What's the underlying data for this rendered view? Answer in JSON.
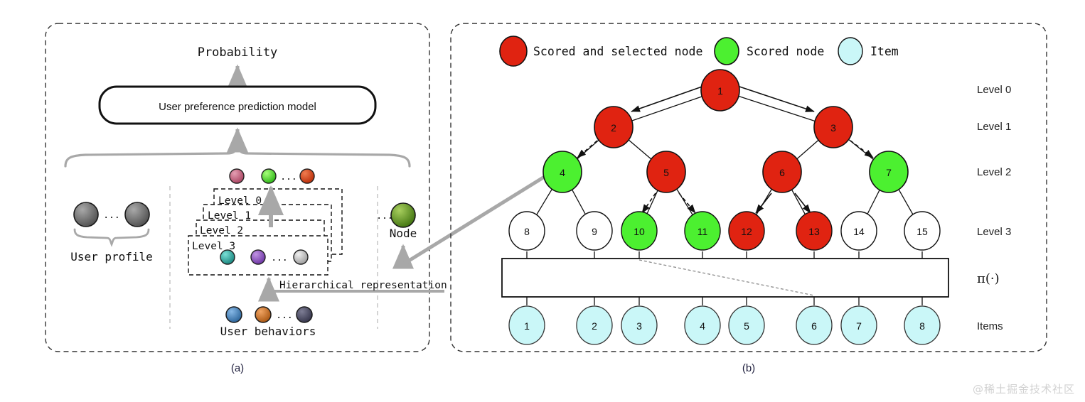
{
  "figure": {
    "panel_a_caption": "(a)",
    "panel_b_caption": "(b)",
    "watermark": "@稀土掘金技术社区"
  },
  "panel_a": {
    "probability_label": "Probability",
    "model_box_label": "User preference prediction model",
    "user_profile_label": "User profile",
    "user_behaviors_label": "User behaviors",
    "hierarchical_label": "Hierarchical representation",
    "node_label": "Node",
    "ellipsis": "...",
    "level_boxes": [
      {
        "label": "Level 0"
      },
      {
        "label": "Level 1"
      },
      {
        "label": "Level 2"
      },
      {
        "label": "Level 3"
      }
    ],
    "embedding_row_top": [
      {
        "color": "#c2657f"
      },
      {
        "color": "#44d62c"
      },
      {
        "color": "#d33a14"
      }
    ],
    "level3_row": [
      {
        "color": "#2aa8a0"
      },
      {
        "color": "#8b4ec4"
      },
      {
        "color": "#b9b9b9"
      }
    ],
    "user_profile_spheres": [
      {
        "color": "#6e6e6e"
      },
      {
        "color": "#6e6e6e"
      }
    ],
    "user_behavior_spheres": [
      {
        "color": "#4a86c8"
      },
      {
        "color": "#d2762a"
      },
      {
        "color": "#4a4a63"
      }
    ],
    "node_sphere": {
      "color": "#63a12b"
    }
  },
  "panel_b": {
    "legend": [
      {
        "label": "Scored and selected node",
        "color": "#e02311",
        "state": "selected"
      },
      {
        "label": "Scored node",
        "color": "#4cf030",
        "state": "scored"
      },
      {
        "label": "Item",
        "color": "#caf7f8",
        "state": "item"
      }
    ],
    "level_labels": [
      "Level 0",
      "Level 1",
      "Level 2",
      "Level 3"
    ],
    "policy_label": "π(·)",
    "items_label": "Items",
    "tree_nodes": [
      {
        "id": "1",
        "level": 0,
        "state": "selected"
      },
      {
        "id": "2",
        "level": 1,
        "state": "selected"
      },
      {
        "id": "3",
        "level": 1,
        "state": "selected"
      },
      {
        "id": "4",
        "level": 2,
        "state": "scored"
      },
      {
        "id": "5",
        "level": 2,
        "state": "selected"
      },
      {
        "id": "6",
        "level": 2,
        "state": "selected"
      },
      {
        "id": "7",
        "level": 2,
        "state": "scored"
      },
      {
        "id": "8",
        "level": 3,
        "state": "plain"
      },
      {
        "id": "9",
        "level": 3,
        "state": "plain"
      },
      {
        "id": "10",
        "level": 3,
        "state": "scored"
      },
      {
        "id": "11",
        "level": 3,
        "state": "scored"
      },
      {
        "id": "12",
        "level": 3,
        "state": "selected"
      },
      {
        "id": "13",
        "level": 3,
        "state": "selected"
      },
      {
        "id": "14",
        "level": 3,
        "state": "plain"
      },
      {
        "id": "15",
        "level": 3,
        "state": "plain"
      }
    ],
    "items": [
      {
        "id": "1"
      },
      {
        "id": "2"
      },
      {
        "id": "3"
      },
      {
        "id": "4"
      },
      {
        "id": "5"
      },
      {
        "id": "6"
      },
      {
        "id": "7"
      },
      {
        "id": "8"
      }
    ]
  },
  "colors": {
    "selected": "#e02311",
    "scored": "#4cf030",
    "item": "#caf7f8",
    "plain": "#ffffff",
    "outline": "#1a1a1a",
    "gray_arrow": "#a8a8a8",
    "panel_border": "#333333"
  }
}
